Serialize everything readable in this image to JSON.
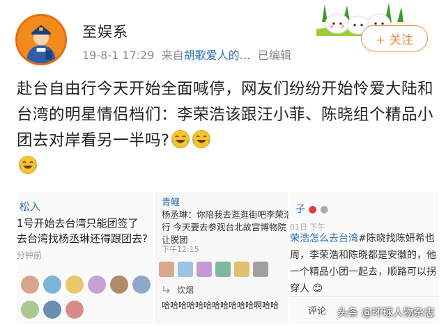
{
  "author": {
    "name": "至娱系",
    "avatar_icon": "police-avatar-icon"
  },
  "meta": {
    "date": "19-8-1 17:29",
    "from_label": "来自",
    "source": "胡歌爱人的…",
    "edited": "已编辑"
  },
  "follow_label": "+ 关注",
  "post": {
    "text": "赴台自由行今天开始全面喊停，网友们纷纷开始怜爱大陆和台湾的明星情侣档们：李荣浩该跟汪小菲、陈晓组个精品小团去对岸看另一半吗?",
    "emoji": "laugh-cry-emoji"
  },
  "panel1": {
    "head": "松入",
    "lines": [
      "1号开始去台湾只能团签了",
      "去台湾找杨丞琳还得跟团去?"
    ],
    "time": "分钟前"
  },
  "panel2": {
    "head": "青鲤",
    "lines": [
      "杨丞琳：你陪我去逛逛街吧李荣浩",
      "行 今天要去参观台北故宫博物院 导",
      "让脱团"
    ],
    "time": "下午12:15",
    "reply_name": "炊烟",
    "reply_text": "哈哈哈哈哈哈哈哈哈哈哈啊哈哈"
  },
  "panel3": {
    "head": "子",
    "date": "01日 下午",
    "line1_blue": "荣浩怎么去台湾",
    "line1_rest": "#陈晓找陈妍希也",
    "line2": "周，李荣浩和陈晓都是安徽的，他",
    "line3": "一个精品小团一起去，顺路可以拐",
    "line4": "穿人",
    "comment_label": "评论"
  },
  "watermark": "头条 @环球人物杂志",
  "colors": {
    "accent": "#f08a3c",
    "link": "#2d6fb8",
    "meta": "#8a8a8a"
  }
}
